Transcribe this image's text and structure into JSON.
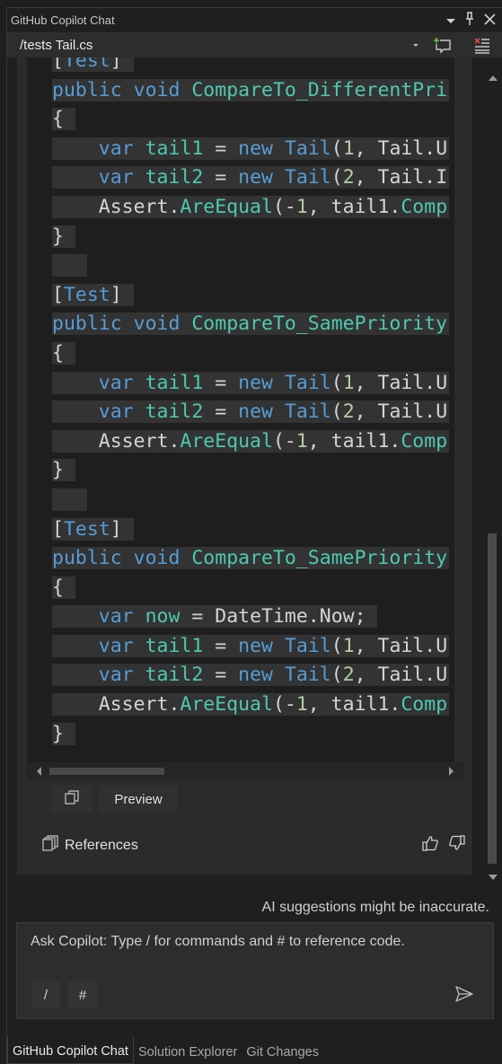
{
  "window": {
    "title": "GitHub Copilot Chat",
    "icons": [
      "window-position-dropdown-icon",
      "pin-icon",
      "close-icon"
    ]
  },
  "thread": {
    "current": "/tests Tail.cs",
    "icons": [
      "thread-dropdown-icon",
      "new-thread-icon",
      "clear-thread-icon"
    ]
  },
  "code": {
    "lines": [
      {
        "sel": true,
        "tokens": [
          {
            "c": "pl",
            "t": "["
          },
          {
            "c": "at",
            "t": "Test"
          },
          {
            "c": "pl",
            "t": "]"
          }
        ]
      },
      {
        "sel": true,
        "tokens": [
          {
            "c": "kw",
            "t": "public"
          },
          {
            "c": "pl",
            "t": " "
          },
          {
            "c": "kw",
            "t": "void"
          },
          {
            "c": "pl",
            "t": " "
          },
          {
            "c": "fn",
            "t": "CompareTo_DifferentPri"
          }
        ]
      },
      {
        "sel": true,
        "tokens": [
          {
            "c": "pl",
            "t": "{"
          }
        ]
      },
      {
        "sel": true,
        "tokens": [
          {
            "c": "pl",
            "t": "    "
          },
          {
            "c": "kw",
            "t": "var"
          },
          {
            "c": "pl",
            "t": " "
          },
          {
            "c": "fn",
            "t": "tail1"
          },
          {
            "c": "pl",
            "t": " = "
          },
          {
            "c": "kw",
            "t": "new"
          },
          {
            "c": "pl",
            "t": " "
          },
          {
            "c": "kw",
            "t": "Tail"
          },
          {
            "c": "pl",
            "t": "("
          },
          {
            "c": "num",
            "t": "1"
          },
          {
            "c": "pl",
            "t": ", Tail.U"
          }
        ]
      },
      {
        "sel": true,
        "tokens": [
          {
            "c": "pl",
            "t": "    "
          },
          {
            "c": "kw",
            "t": "var"
          },
          {
            "c": "pl",
            "t": " "
          },
          {
            "c": "fn",
            "t": "tail2"
          },
          {
            "c": "pl",
            "t": " = "
          },
          {
            "c": "kw",
            "t": "new"
          },
          {
            "c": "pl",
            "t": " "
          },
          {
            "c": "kw",
            "t": "Tail"
          },
          {
            "c": "pl",
            "t": "("
          },
          {
            "c": "num",
            "t": "2"
          },
          {
            "c": "pl",
            "t": ", Tail.I"
          }
        ]
      },
      {
        "sel": true,
        "tokens": [
          {
            "c": "pl",
            "t": "    Assert."
          },
          {
            "c": "mt",
            "t": "AreEqual"
          },
          {
            "c": "pl",
            "t": "(-"
          },
          {
            "c": "num",
            "t": "1"
          },
          {
            "c": "pl",
            "t": ", tail1."
          },
          {
            "c": "mt",
            "t": "Comp"
          }
        ]
      },
      {
        "sel": true,
        "tokens": [
          {
            "c": "pl",
            "t": "}"
          }
        ]
      },
      {
        "sel": true,
        "tokens": [
          {
            "c": "pl",
            "t": ""
          }
        ]
      },
      {
        "sel": true,
        "tokens": [
          {
            "c": "pl",
            "t": "["
          },
          {
            "c": "at",
            "t": "Test"
          },
          {
            "c": "pl",
            "t": "]"
          }
        ]
      },
      {
        "sel": true,
        "tokens": [
          {
            "c": "kw",
            "t": "public"
          },
          {
            "c": "pl",
            "t": " "
          },
          {
            "c": "kw",
            "t": "void"
          },
          {
            "c": "pl",
            "t": " "
          },
          {
            "c": "fn",
            "t": "CompareTo_SamePriority"
          }
        ]
      },
      {
        "sel": true,
        "tokens": [
          {
            "c": "pl",
            "t": "{"
          }
        ]
      },
      {
        "sel": true,
        "tokens": [
          {
            "c": "pl",
            "t": "    "
          },
          {
            "c": "kw",
            "t": "var"
          },
          {
            "c": "pl",
            "t": " "
          },
          {
            "c": "fn",
            "t": "tail1"
          },
          {
            "c": "pl",
            "t": " = "
          },
          {
            "c": "kw",
            "t": "new"
          },
          {
            "c": "pl",
            "t": " "
          },
          {
            "c": "kw",
            "t": "Tail"
          },
          {
            "c": "pl",
            "t": "("
          },
          {
            "c": "num",
            "t": "1"
          },
          {
            "c": "pl",
            "t": ", Tail.U"
          }
        ]
      },
      {
        "sel": true,
        "tokens": [
          {
            "c": "pl",
            "t": "    "
          },
          {
            "c": "kw",
            "t": "var"
          },
          {
            "c": "pl",
            "t": " "
          },
          {
            "c": "fn",
            "t": "tail2"
          },
          {
            "c": "pl",
            "t": " = "
          },
          {
            "c": "kw",
            "t": "new"
          },
          {
            "c": "pl",
            "t": " "
          },
          {
            "c": "kw",
            "t": "Tail"
          },
          {
            "c": "pl",
            "t": "("
          },
          {
            "c": "num",
            "t": "2"
          },
          {
            "c": "pl",
            "t": ", Tail.U"
          }
        ]
      },
      {
        "sel": true,
        "tokens": [
          {
            "c": "pl",
            "t": "    Assert."
          },
          {
            "c": "mt",
            "t": "AreEqual"
          },
          {
            "c": "pl",
            "t": "(-"
          },
          {
            "c": "num",
            "t": "1"
          },
          {
            "c": "pl",
            "t": ", tail1."
          },
          {
            "c": "mt",
            "t": "Comp"
          }
        ]
      },
      {
        "sel": true,
        "tokens": [
          {
            "c": "pl",
            "t": "}"
          }
        ]
      },
      {
        "sel": true,
        "tokens": [
          {
            "c": "pl",
            "t": ""
          }
        ]
      },
      {
        "sel": true,
        "tokens": [
          {
            "c": "pl",
            "t": "["
          },
          {
            "c": "at",
            "t": "Test"
          },
          {
            "c": "pl",
            "t": "]"
          }
        ]
      },
      {
        "sel": true,
        "tokens": [
          {
            "c": "kw",
            "t": "public"
          },
          {
            "c": "pl",
            "t": " "
          },
          {
            "c": "kw",
            "t": "void"
          },
          {
            "c": "pl",
            "t": " "
          },
          {
            "c": "fn",
            "t": "CompareTo_SamePriority"
          }
        ]
      },
      {
        "sel": true,
        "tokens": [
          {
            "c": "pl",
            "t": "{"
          }
        ]
      },
      {
        "sel": true,
        "tokens": [
          {
            "c": "pl",
            "t": "    "
          },
          {
            "c": "kw",
            "t": "var"
          },
          {
            "c": "pl",
            "t": " "
          },
          {
            "c": "fn",
            "t": "now"
          },
          {
            "c": "pl",
            "t": " = DateTime.Now;"
          }
        ]
      },
      {
        "sel": true,
        "tokens": [
          {
            "c": "pl",
            "t": "    "
          },
          {
            "c": "kw",
            "t": "var"
          },
          {
            "c": "pl",
            "t": " "
          },
          {
            "c": "fn",
            "t": "tail1"
          },
          {
            "c": "pl",
            "t": " = "
          },
          {
            "c": "kw",
            "t": "new"
          },
          {
            "c": "pl",
            "t": " "
          },
          {
            "c": "kw",
            "t": "Tail"
          },
          {
            "c": "pl",
            "t": "("
          },
          {
            "c": "num",
            "t": "1"
          },
          {
            "c": "pl",
            "t": ", Tail.U"
          }
        ]
      },
      {
        "sel": true,
        "tokens": [
          {
            "c": "pl",
            "t": "    "
          },
          {
            "c": "kw",
            "t": "var"
          },
          {
            "c": "pl",
            "t": " "
          },
          {
            "c": "fn",
            "t": "tail2"
          },
          {
            "c": "pl",
            "t": " = "
          },
          {
            "c": "kw",
            "t": "new"
          },
          {
            "c": "pl",
            "t": " "
          },
          {
            "c": "kw",
            "t": "Tail"
          },
          {
            "c": "pl",
            "t": "("
          },
          {
            "c": "num",
            "t": "2"
          },
          {
            "c": "pl",
            "t": ", Tail.U"
          }
        ]
      },
      {
        "sel": true,
        "tokens": [
          {
            "c": "pl",
            "t": "    Assert."
          },
          {
            "c": "mt",
            "t": "AreEqual"
          },
          {
            "c": "pl",
            "t": "(-"
          },
          {
            "c": "num",
            "t": "1"
          },
          {
            "c": "pl",
            "t": ", tail1."
          },
          {
            "c": "mt",
            "t": "Comp"
          }
        ]
      },
      {
        "sel": true,
        "tokens": [
          {
            "c": "pl",
            "t": "}"
          }
        ]
      }
    ]
  },
  "code_actions": {
    "copy_icon": "copy-icon",
    "preview_label": "Preview"
  },
  "references": {
    "label": "References",
    "icon": "references-icon"
  },
  "feedback": {
    "thumbs_up_icon": "thumbs-up-icon",
    "thumbs_down_icon": "thumbs-down-icon"
  },
  "disclaimer": "AI suggestions might be inaccurate.",
  "input": {
    "placeholder": "Ask Copilot: Type / for commands and # to reference code.",
    "value": "",
    "slash_chip": "/",
    "hash_chip": "#",
    "send_icon": "send-icon"
  },
  "bottom_tabs": [
    {
      "label": "GitHub Copilot Chat",
      "active": true
    },
    {
      "label": "Solution Explorer",
      "active": false
    },
    {
      "label": "Git Changes",
      "active": false
    }
  ],
  "colors": {
    "keyword": "#569cd6",
    "type": "#4ec9b0",
    "number": "#b5cea8",
    "plain": "#d4d4d4",
    "selection": "#333333",
    "code_background": "#1e1e1e"
  }
}
